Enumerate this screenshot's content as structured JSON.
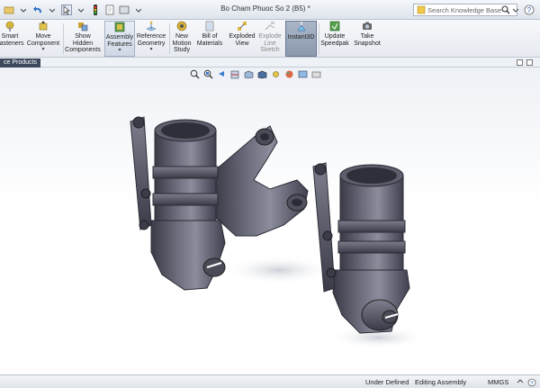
{
  "window": {
    "title": "Bo Cham Phuoc So 2 (B5) *"
  },
  "search": {
    "placeholder": "Search Knowledge Base"
  },
  "ribbon": {
    "smart_fasteners": "Smart Fasteners",
    "move_component": "Move Component",
    "show_hidden": "Show Hidden Components",
    "assembly_features": "Assembly Features",
    "reference_geometry": "Reference Geometry",
    "new_motion_study": "New Motion Study",
    "bill_of_materials": "Bill of Materials",
    "exploded_view": "Exploded View",
    "explode_line_sketch": "Explode Line Sketch",
    "instant3d": "Instant3D",
    "update_speedpak": "Update Speedpak",
    "take_snapshot": "Take Snapshot"
  },
  "tabs": {
    "reference_products": "ce Products"
  },
  "status": {
    "under_defined": "Under Defined",
    "editing": "Editing Assembly",
    "units": "MMGS"
  },
  "colors": {
    "part": "#5a5b6a",
    "part_dark": "#2f3038",
    "part_light": "#8a8b9a",
    "instant_active": "#8b98ad",
    "tab_bg": "#3d4a5e"
  },
  "icons": {
    "save": "save-icon",
    "print": "print-icon",
    "undo": "undo-icon",
    "select": "cursor-icon",
    "rebuild": "traffic-light-icon",
    "search": "search-icon",
    "help": "help-icon"
  }
}
